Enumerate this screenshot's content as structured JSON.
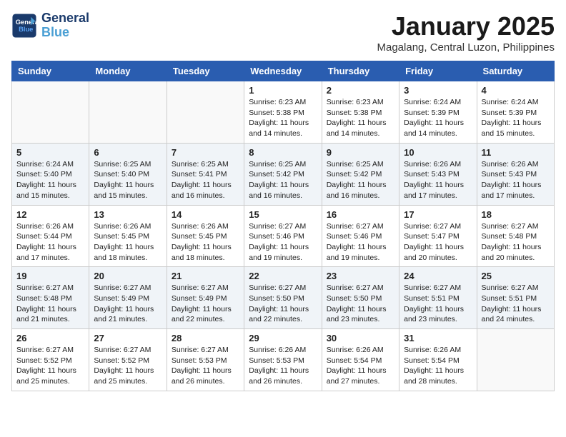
{
  "header": {
    "logo_line1": "General",
    "logo_line2": "Blue",
    "title": "January 2025",
    "subtitle": "Magalang, Central Luzon, Philippines"
  },
  "weekdays": [
    "Sunday",
    "Monday",
    "Tuesday",
    "Wednesday",
    "Thursday",
    "Friday",
    "Saturday"
  ],
  "weeks": [
    [
      {
        "day": "",
        "sunrise": "",
        "sunset": "",
        "daylight": ""
      },
      {
        "day": "",
        "sunrise": "",
        "sunset": "",
        "daylight": ""
      },
      {
        "day": "",
        "sunrise": "",
        "sunset": "",
        "daylight": ""
      },
      {
        "day": "1",
        "sunrise": "Sunrise: 6:23 AM",
        "sunset": "Sunset: 5:38 PM",
        "daylight": "Daylight: 11 hours and 14 minutes."
      },
      {
        "day": "2",
        "sunrise": "Sunrise: 6:23 AM",
        "sunset": "Sunset: 5:38 PM",
        "daylight": "Daylight: 11 hours and 14 minutes."
      },
      {
        "day": "3",
        "sunrise": "Sunrise: 6:24 AM",
        "sunset": "Sunset: 5:39 PM",
        "daylight": "Daylight: 11 hours and 14 minutes."
      },
      {
        "day": "4",
        "sunrise": "Sunrise: 6:24 AM",
        "sunset": "Sunset: 5:39 PM",
        "daylight": "Daylight: 11 hours and 15 minutes."
      }
    ],
    [
      {
        "day": "5",
        "sunrise": "Sunrise: 6:24 AM",
        "sunset": "Sunset: 5:40 PM",
        "daylight": "Daylight: 11 hours and 15 minutes."
      },
      {
        "day": "6",
        "sunrise": "Sunrise: 6:25 AM",
        "sunset": "Sunset: 5:40 PM",
        "daylight": "Daylight: 11 hours and 15 minutes."
      },
      {
        "day": "7",
        "sunrise": "Sunrise: 6:25 AM",
        "sunset": "Sunset: 5:41 PM",
        "daylight": "Daylight: 11 hours and 16 minutes."
      },
      {
        "day": "8",
        "sunrise": "Sunrise: 6:25 AM",
        "sunset": "Sunset: 5:42 PM",
        "daylight": "Daylight: 11 hours and 16 minutes."
      },
      {
        "day": "9",
        "sunrise": "Sunrise: 6:25 AM",
        "sunset": "Sunset: 5:42 PM",
        "daylight": "Daylight: 11 hours and 16 minutes."
      },
      {
        "day": "10",
        "sunrise": "Sunrise: 6:26 AM",
        "sunset": "Sunset: 5:43 PM",
        "daylight": "Daylight: 11 hours and 17 minutes."
      },
      {
        "day": "11",
        "sunrise": "Sunrise: 6:26 AM",
        "sunset": "Sunset: 5:43 PM",
        "daylight": "Daylight: 11 hours and 17 minutes."
      }
    ],
    [
      {
        "day": "12",
        "sunrise": "Sunrise: 6:26 AM",
        "sunset": "Sunset: 5:44 PM",
        "daylight": "Daylight: 11 hours and 17 minutes."
      },
      {
        "day": "13",
        "sunrise": "Sunrise: 6:26 AM",
        "sunset": "Sunset: 5:45 PM",
        "daylight": "Daylight: 11 hours and 18 minutes."
      },
      {
        "day": "14",
        "sunrise": "Sunrise: 6:26 AM",
        "sunset": "Sunset: 5:45 PM",
        "daylight": "Daylight: 11 hours and 18 minutes."
      },
      {
        "day": "15",
        "sunrise": "Sunrise: 6:27 AM",
        "sunset": "Sunset: 5:46 PM",
        "daylight": "Daylight: 11 hours and 19 minutes."
      },
      {
        "day": "16",
        "sunrise": "Sunrise: 6:27 AM",
        "sunset": "Sunset: 5:46 PM",
        "daylight": "Daylight: 11 hours and 19 minutes."
      },
      {
        "day": "17",
        "sunrise": "Sunrise: 6:27 AM",
        "sunset": "Sunset: 5:47 PM",
        "daylight": "Daylight: 11 hours and 20 minutes."
      },
      {
        "day": "18",
        "sunrise": "Sunrise: 6:27 AM",
        "sunset": "Sunset: 5:48 PM",
        "daylight": "Daylight: 11 hours and 20 minutes."
      }
    ],
    [
      {
        "day": "19",
        "sunrise": "Sunrise: 6:27 AM",
        "sunset": "Sunset: 5:48 PM",
        "daylight": "Daylight: 11 hours and 21 minutes."
      },
      {
        "day": "20",
        "sunrise": "Sunrise: 6:27 AM",
        "sunset": "Sunset: 5:49 PM",
        "daylight": "Daylight: 11 hours and 21 minutes."
      },
      {
        "day": "21",
        "sunrise": "Sunrise: 6:27 AM",
        "sunset": "Sunset: 5:49 PM",
        "daylight": "Daylight: 11 hours and 22 minutes."
      },
      {
        "day": "22",
        "sunrise": "Sunrise: 6:27 AM",
        "sunset": "Sunset: 5:50 PM",
        "daylight": "Daylight: 11 hours and 22 minutes."
      },
      {
        "day": "23",
        "sunrise": "Sunrise: 6:27 AM",
        "sunset": "Sunset: 5:50 PM",
        "daylight": "Daylight: 11 hours and 23 minutes."
      },
      {
        "day": "24",
        "sunrise": "Sunrise: 6:27 AM",
        "sunset": "Sunset: 5:51 PM",
        "daylight": "Daylight: 11 hours and 23 minutes."
      },
      {
        "day": "25",
        "sunrise": "Sunrise: 6:27 AM",
        "sunset": "Sunset: 5:51 PM",
        "daylight": "Daylight: 11 hours and 24 minutes."
      }
    ],
    [
      {
        "day": "26",
        "sunrise": "Sunrise: 6:27 AM",
        "sunset": "Sunset: 5:52 PM",
        "daylight": "Daylight: 11 hours and 25 minutes."
      },
      {
        "day": "27",
        "sunrise": "Sunrise: 6:27 AM",
        "sunset": "Sunset: 5:52 PM",
        "daylight": "Daylight: 11 hours and 25 minutes."
      },
      {
        "day": "28",
        "sunrise": "Sunrise: 6:27 AM",
        "sunset": "Sunset: 5:53 PM",
        "daylight": "Daylight: 11 hours and 26 minutes."
      },
      {
        "day": "29",
        "sunrise": "Sunrise: 6:26 AM",
        "sunset": "Sunset: 5:53 PM",
        "daylight": "Daylight: 11 hours and 26 minutes."
      },
      {
        "day": "30",
        "sunrise": "Sunrise: 6:26 AM",
        "sunset": "Sunset: 5:54 PM",
        "daylight": "Daylight: 11 hours and 27 minutes."
      },
      {
        "day": "31",
        "sunrise": "Sunrise: 6:26 AM",
        "sunset": "Sunset: 5:54 PM",
        "daylight": "Daylight: 11 hours and 28 minutes."
      },
      {
        "day": "",
        "sunrise": "",
        "sunset": "",
        "daylight": ""
      }
    ]
  ]
}
